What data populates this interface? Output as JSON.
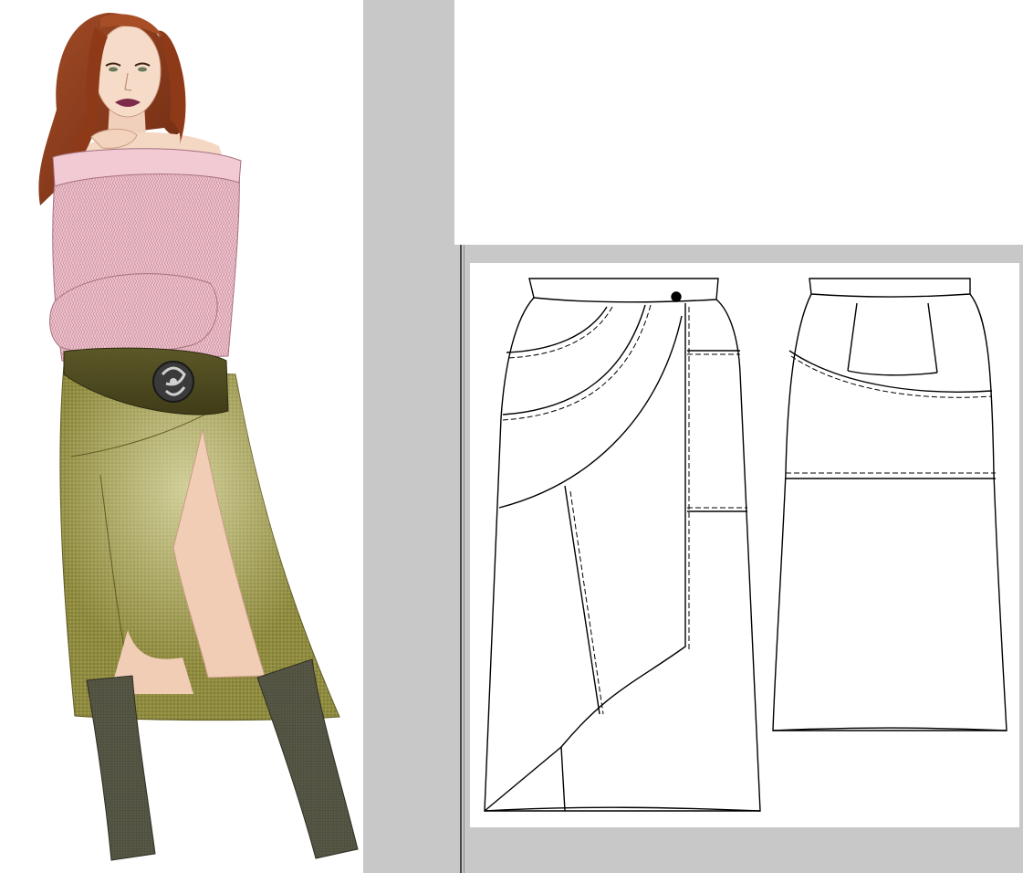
{
  "illustration": {
    "description_icon": "fashion-figure-icon",
    "colors": {
      "hair": "#8a3a1c",
      "skin": "#f6dcc8",
      "sweater": "#eab8c4",
      "belt": "#4f4b22",
      "skirt": "#8e8a3e",
      "boots": "#4a4a38"
    }
  },
  "sketch": {
    "front_view_icon": "skirt-front-sketch-icon",
    "back_view_icon": "skirt-back-sketch-icon"
  }
}
